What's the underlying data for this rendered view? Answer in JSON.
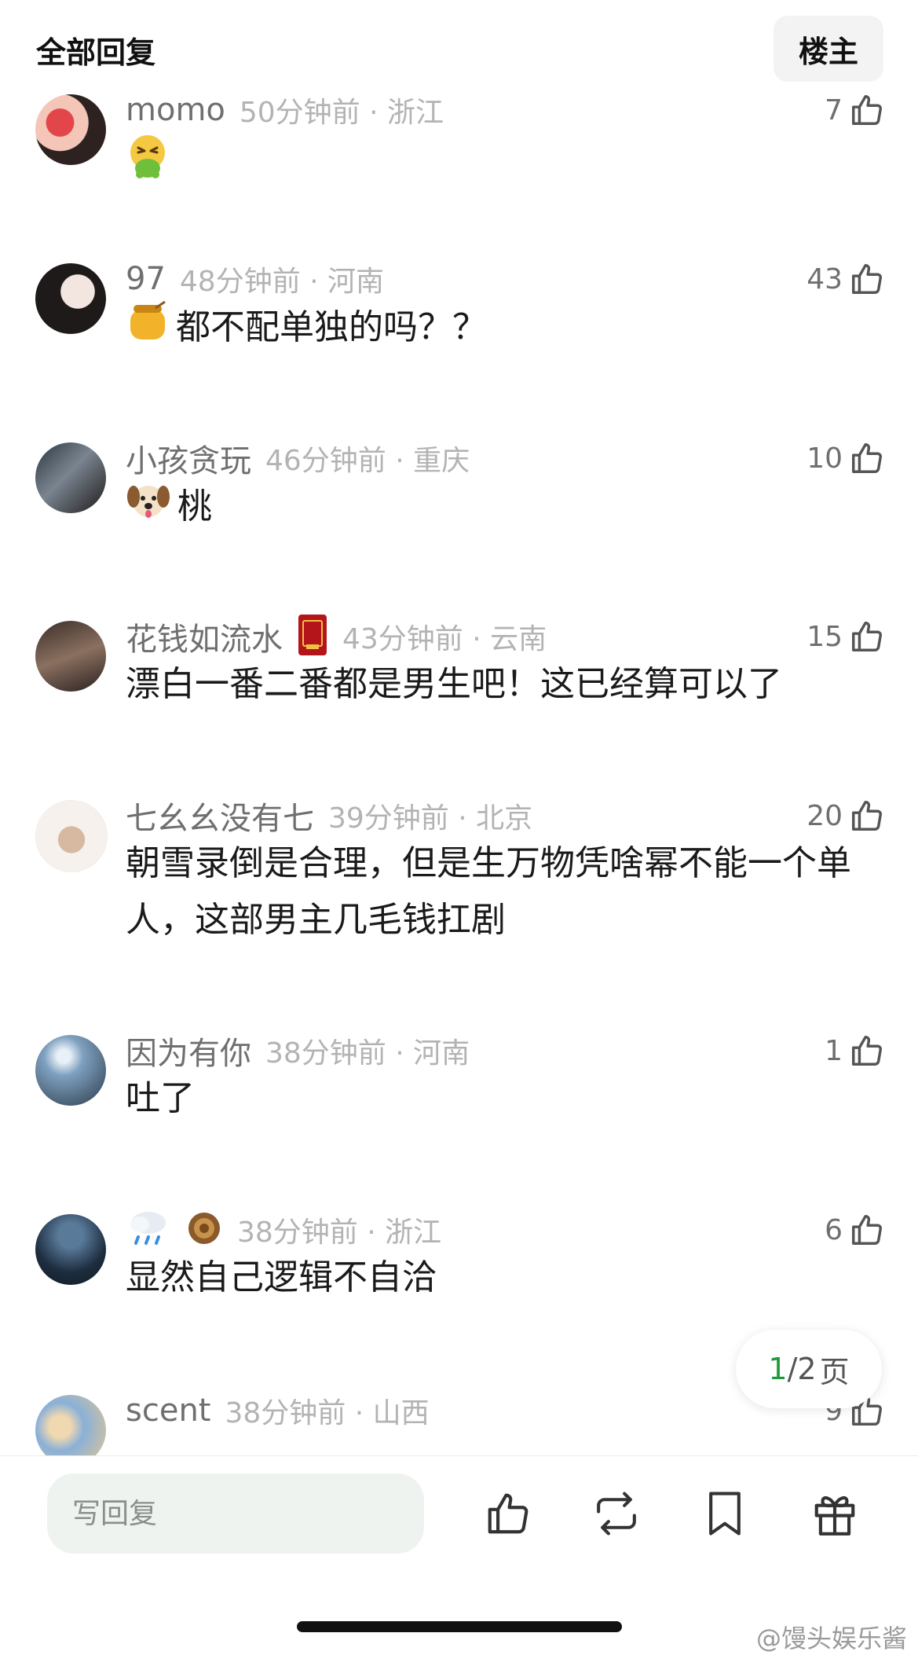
{
  "header": {
    "title": "全部回复",
    "owner_button": "楼主"
  },
  "comments": [
    {
      "username": "momo",
      "time": "50分钟前 · 浙江",
      "likes": "7",
      "text": "",
      "emoji": "vomiting-face"
    },
    {
      "username": "97",
      "time": "48分钟前 · 河南",
      "likes": "43",
      "text": "都不配单独的吗？？",
      "emoji": "honey-pot"
    },
    {
      "username": "小孩贪玩",
      "time": "46分钟前 · 重庆",
      "likes": "10",
      "text": "桃",
      "emoji": "dog-face"
    },
    {
      "username": "花钱如流水",
      "time": "43分钟前 · 云南",
      "likes": "15",
      "text": "漂白一番二番都是男生吧！这已经算可以了",
      "badge": "red-book-badge"
    },
    {
      "username": "七幺幺没有七",
      "time": "39分钟前 · 北京",
      "likes": "20",
      "text": "朝雪录倒是合理，但是生万物凭啥幂不能一个单人，这部男主几毛钱扛剧"
    },
    {
      "username": "因为有你",
      "time": "38分钟前 · 河南",
      "likes": "1",
      "text": "吐了"
    },
    {
      "username": "",
      "time": "38分钟前 · 浙江",
      "likes": "6",
      "text": "显然自己逻辑不自洽",
      "badge": "rain-cloud-and-medal"
    },
    {
      "username": "scent",
      "time": "38分钟前 · 山西",
      "likes": "9",
      "text": ""
    }
  ],
  "pager": {
    "current": "1",
    "total": "/2",
    "unit": "页"
  },
  "bottom_bar": {
    "reply_placeholder": "写回复"
  },
  "watermark": "@馒头娱乐酱",
  "colors": {
    "accent": "#1e9a3c",
    "meta_gray": "#b3b3b3",
    "name_gray": "#6f6f6f"
  }
}
